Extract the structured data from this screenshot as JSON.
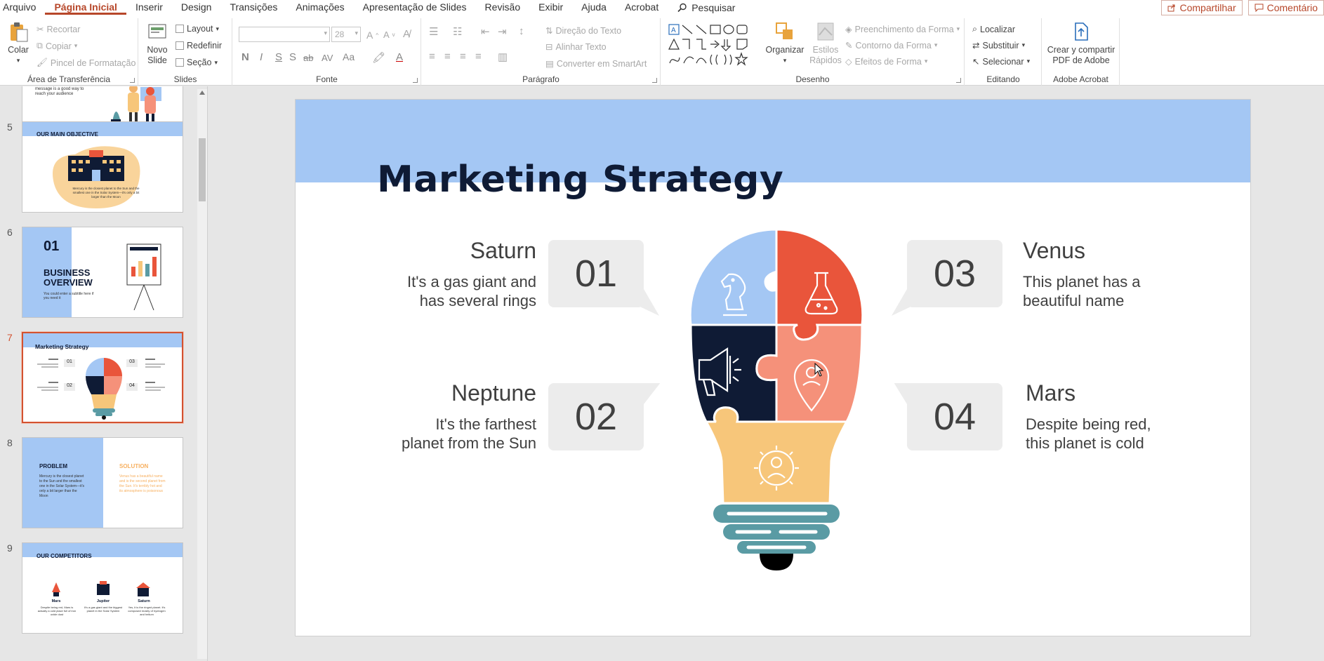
{
  "menu": {
    "tabs": [
      "Arquivo",
      "Página Inicial",
      "Inserir",
      "Design",
      "Transições",
      "Animações",
      "Apresentação de Slides",
      "Revisão",
      "Exibir",
      "Ajuda",
      "Acrobat"
    ],
    "search": "Pesquisar",
    "share": "Compartilhar",
    "comments": "Comentário"
  },
  "ribbon": {
    "clipboard": {
      "paste": "Colar",
      "cut": "Recortar",
      "copy": "Copiar",
      "format_painter": "Pincel de Formatação",
      "label": "Área de Transferência"
    },
    "slides": {
      "new_slide_1": "Novo",
      "new_slide_2": "Slide",
      "layout": "Layout",
      "reset": "Redefinir",
      "section": "Seção",
      "label": "Slides"
    },
    "font": {
      "size": "28",
      "bold": "N",
      "italic": "I",
      "underline": "S",
      "shadow": "S",
      "strike": "ab",
      "spacing": "AV",
      "case": "Aa",
      "label": "Fonte"
    },
    "paragraph": {
      "text_direction": "Direção do Texto",
      "align_text": "Alinhar Texto",
      "smartart": "Converter em SmartArt",
      "label": "Parágrafo"
    },
    "drawing": {
      "arrange": "Organizar",
      "quick_styles_1": "Estilos",
      "quick_styles_2": "Rápidos",
      "shape_fill": "Preenchimento da Forma",
      "shape_outline": "Contorno da Forma",
      "shape_effects": "Efeitos de Forma",
      "label": "Desenho"
    },
    "editing": {
      "find": "Localizar",
      "replace": "Substituir",
      "select": "Selecionar",
      "label": "Editando"
    },
    "acrobat": {
      "create_1": "Crear y compartir",
      "create_2": "PDF de Adobe",
      "label": "Adobe Acrobat"
    }
  },
  "thumbnails": [
    {
      "num": "",
      "title": "",
      "text": "message is a good way to reach your audience"
    },
    {
      "num": "5",
      "title": "OUR MAIN OBJECTIVE",
      "text": "Mercury is the closest planet to the Sun and the smallest one in the Solar System—it's only a bit larger than the Moon"
    },
    {
      "num": "6",
      "title": "BUSINESS OVERVIEW",
      "big": "01",
      "text": "You could enter a subtitle here if you need it"
    },
    {
      "num": "7",
      "title": "Marketing Strategy",
      "selected": true
    },
    {
      "num": "8",
      "title": "PROBLEM",
      "title2": "SOLUTION",
      "text": "Mercury is the closest planet to the Sun and the smallest one in the Solar System—it's only a bit larger than the Moon",
      "text2": "Venus has a beautiful name and is the second planet from the Sun. It's terribly hot and its atmosphere is poisonous"
    },
    {
      "num": "9",
      "title": "OUR COMPETITORS",
      "c1": "Mars",
      "c2": "Jupiter",
      "c3": "Saturn",
      "d1": "Despite being red, Mars is actually a cold place full of iron oxide dust",
      "d2": "It's a gas giant and the biggest planet in the Solar System",
      "d3": "Yes, it is the ringed planet. It's composed mostly of hydrogen and helium"
    }
  ],
  "slide": {
    "title": "Marketing Strategy",
    "points": [
      {
        "num": "01",
        "name": "Saturn",
        "desc1": "It's a gas giant and",
        "desc2": "has several rings"
      },
      {
        "num": "02",
        "name": "Neptune",
        "desc1": "It's the farthest",
        "desc2": "planet from the Sun"
      },
      {
        "num": "03",
        "name": "Venus",
        "desc1": "This planet has a",
        "desc2": "beautiful name"
      },
      {
        "num": "04",
        "name": "Mars",
        "desc1": "Despite being red,",
        "desc2": "this planet is cold"
      }
    ]
  },
  "colors": {
    "accent": "#b7472a",
    "band": "#a4c7f4",
    "navy": "#0f1b35",
    "red": "#e9553b",
    "salmon": "#f5917a",
    "yellow": "#f7c67a",
    "teal": "#5a9ba4",
    "blue": "#a4c7f4",
    "bubble": "#ececec"
  }
}
